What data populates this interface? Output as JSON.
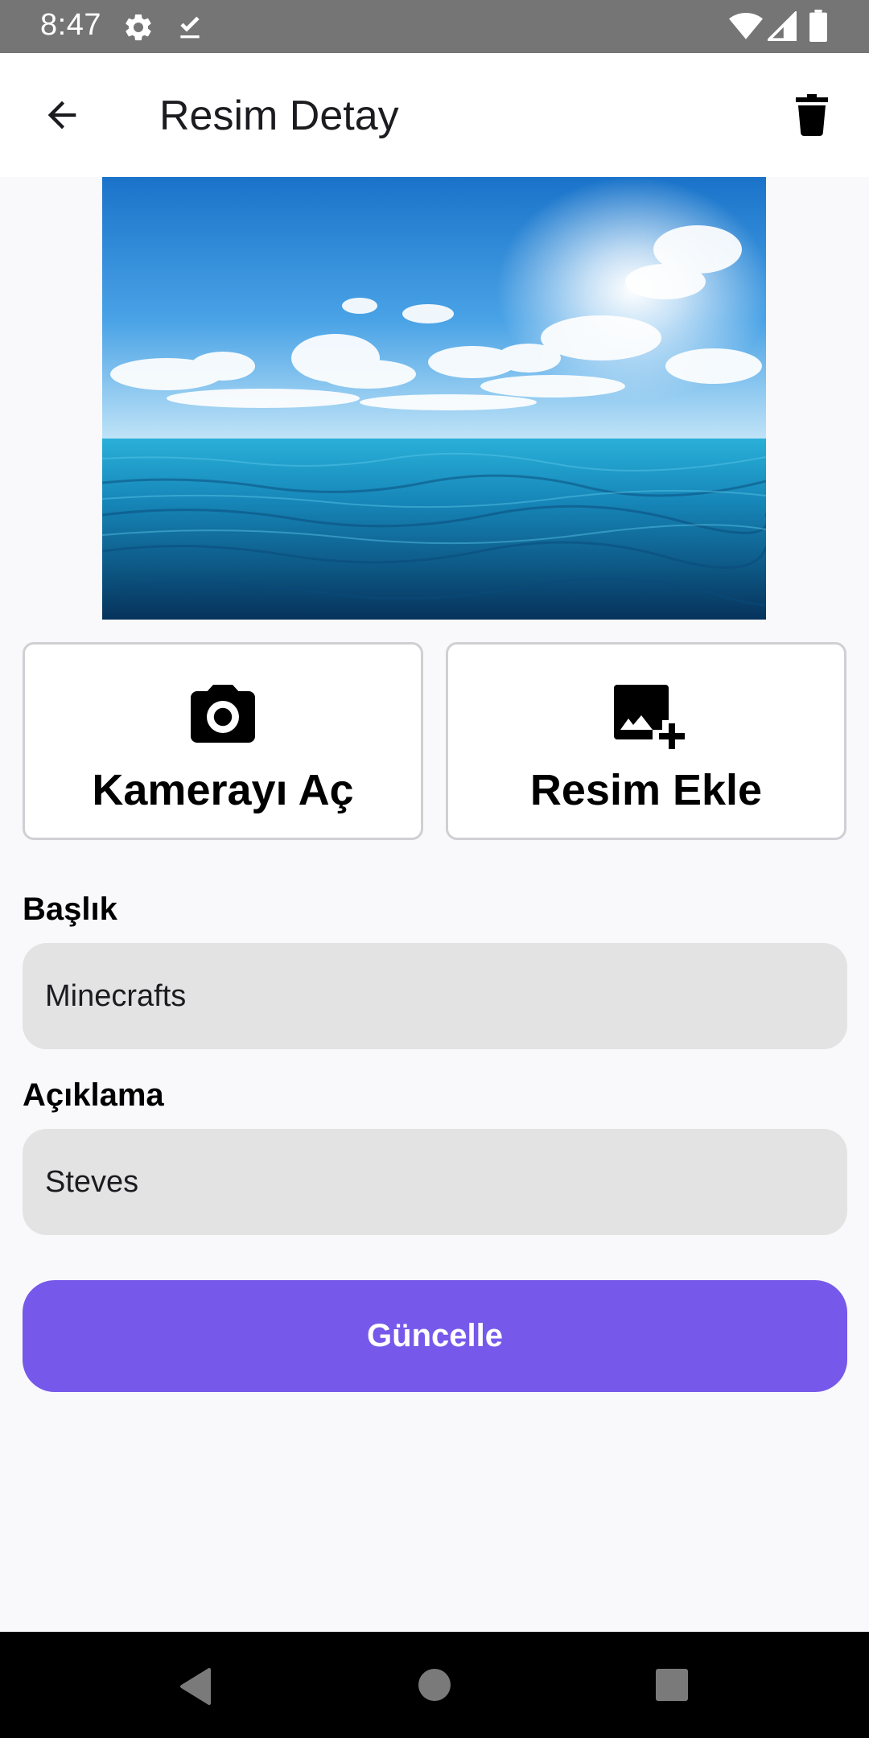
{
  "status_bar": {
    "time": "8:47",
    "icons": [
      "gear-icon",
      "download-done-icon",
      "wifi-icon",
      "signal-icon",
      "battery-icon"
    ]
  },
  "app_bar": {
    "title": "Resim Detay",
    "back_icon": "arrow-back-icon",
    "delete_icon": "trash-icon"
  },
  "image": {
    "description_icon": "photo"
  },
  "actions": {
    "camera_label": "Kamerayı Aç",
    "camera_icon": "camera-icon",
    "gallery_label": "Resim Ekle",
    "gallery_icon": "add-photo-icon"
  },
  "form": {
    "title_label": "Başlık",
    "title_value": "Minecrafts",
    "description_label": "Açıklama",
    "description_value": "Steves"
  },
  "update_button": {
    "label": "Güncelle",
    "color": "#7659ea"
  },
  "colors": {
    "status_bar": "#757575",
    "background": "#f9f9fc",
    "input_bg": "#e3e3e3",
    "accent": "#7659ea"
  }
}
